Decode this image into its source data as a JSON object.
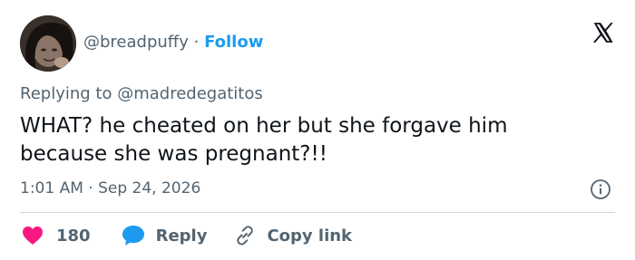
{
  "header": {
    "handle": "@breadpuffy",
    "separator": "·",
    "follow_label": "Follow"
  },
  "tweet": {
    "replying_prefix": "Replying to",
    "replying_to": "@madredegatitos",
    "text": "WHAT? he cheated on her but she forgave him because she was pregnant?!!",
    "time": "1:01 AM",
    "meta_separator": "·",
    "date": "Sep 24, 2026"
  },
  "actions": {
    "like_count": "180",
    "reply_label": "Reply",
    "copy_link_label": "Copy link"
  },
  "icons": {
    "like": "heart-icon",
    "reply": "speech-bubble-icon",
    "copy": "link-icon",
    "info": "info-icon",
    "brand": "x-logo-icon"
  },
  "colors": {
    "like": "#f91880",
    "reply": "#1d9bf0",
    "follow": "#1d9bf0",
    "secondary_text": "#536471",
    "primary_text": "#0f1419"
  }
}
